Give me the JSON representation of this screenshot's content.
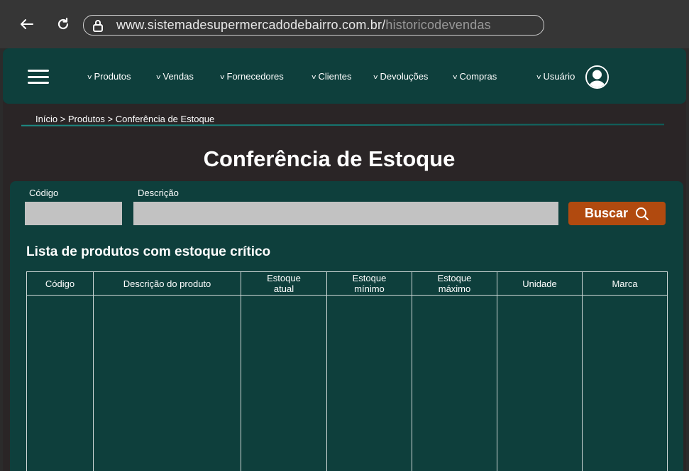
{
  "browser": {
    "url_host": "www.sistemadesupermercadodebairro.com.br/",
    "url_path": "historicodevendas",
    "back_icon": "arrow-left-icon",
    "reload_icon": "reload-icon",
    "lock_icon": "lock-icon"
  },
  "nav": {
    "menu_icon": "hamburger-menu-icon",
    "items": [
      {
        "label": "Produtos"
      },
      {
        "label": "Vendas"
      },
      {
        "label": "Fornecedores"
      },
      {
        "label": "Clientes"
      },
      {
        "label": "Devoluções"
      },
      {
        "label": "Compras"
      }
    ],
    "user_label": "Usuário",
    "user_icon": "user-avatar-icon"
  },
  "breadcrumb": "Início > Produtos > Conferência de Estoque",
  "page_title": "Conferência de Estoque",
  "search": {
    "code_label": "Código",
    "code_value": "",
    "description_label": "Descrição",
    "description_value": "",
    "button_label": "Buscar",
    "button_icon": "search-icon"
  },
  "list": {
    "title": "Lista de produtos com estoque crítico",
    "columns": [
      "Código",
      "Descrição do produto",
      "Estoque\natual",
      "Estoque\nmínimo",
      "Estoque\nmáximo",
      "Unidade",
      "Marca"
    ],
    "rows": []
  },
  "colors": {
    "primary": "#0e3f3c",
    "accent": "#b14a0f",
    "background": "#2a2526",
    "input": "#c2c2c2"
  }
}
